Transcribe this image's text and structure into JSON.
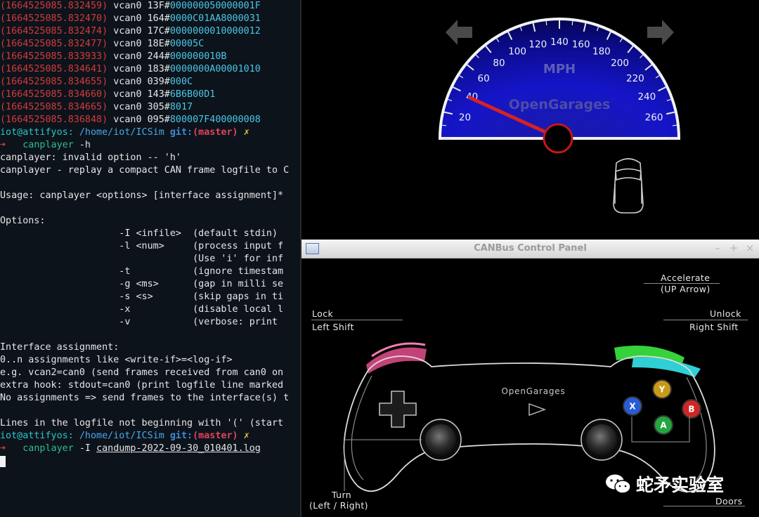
{
  "terminal": {
    "dump_lines": [
      {
        "ts": "(1664525085.832459)",
        "iface": "vcan0",
        "id": "13F",
        "data": "00000005",
        "data_hi": "0000001F"
      },
      {
        "ts": "(1664525085.832470)",
        "iface": "vcan0",
        "id": "164",
        "data": "0000C01AA8000031",
        "data_hi": ""
      },
      {
        "ts": "(1664525085.832474)",
        "iface": "vcan0",
        "id": "17C",
        "data": "0000000010000012",
        "data_hi": ""
      },
      {
        "ts": "(1664525085.832477)",
        "iface": "vcan0",
        "id": "18E",
        "data": "00005C",
        "data_hi": ""
      },
      {
        "ts": "(1664525085.833933)",
        "iface": "vcan0",
        "id": "244",
        "data": "000000010B",
        "data_hi": ""
      },
      {
        "ts": "(1664525085.834641)",
        "iface": "vcan0",
        "id": "183",
        "data": "0000000A00001010",
        "data_hi": ""
      },
      {
        "ts": "(1664525085.834655)",
        "iface": "vcan0",
        "id": "039",
        "data": "000C",
        "data_hi": ""
      },
      {
        "ts": "(1664525085.834660)",
        "iface": "vcan0",
        "id": "143",
        "data": "6B6B00D1",
        "data_hi": ""
      },
      {
        "ts": "(1664525085.834665)",
        "iface": "vcan0",
        "id": "305",
        "data": "8017",
        "data_hi": ""
      },
      {
        "ts": "(1664525085.836848)",
        "iface": "vcan0",
        "id": "095",
        "data": "800007F400000008",
        "data_hi": ""
      }
    ],
    "prompt": {
      "user": "iot@attifyos:",
      "path": "/home/iot/ICSim",
      "git": "git:",
      "branch": "(master)",
      "mark": "✗",
      "arrow": "➜"
    },
    "cmd1": {
      "name": "canplayer",
      "args": " -h"
    },
    "output": [
      "canplayer: invalid option -- 'h'",
      "canplayer - replay a compact CAN frame logfile to C",
      "",
      "Usage: canplayer <options> [interface assignment]*",
      "",
      "Options:",
      "                     -I <infile>  (default stdin)",
      "                     -l <num>     (process input f",
      "                                  (Use 'i' for inf",
      "                     -t           (ignore timestam",
      "                     -g <ms>      (gap in milli se",
      "                     -s <s>       (skip gaps in ti",
      "                     -x           (disable local l",
      "                     -v           (verbose: print",
      "",
      "Interface assignment:",
      "0..n assignments like <write-if>=<log-if>",
      "e.g. vcan2=can0 (send frames received from can0 on",
      "extra hook: stdout=can0 (print logfile line marked",
      "No assignments => send frames to the interface(s) t",
      "",
      "Lines in the logfile not beginning with '(' (start"
    ],
    "cmd2": {
      "name": "canplayer",
      "args_prefix": " -I ",
      "file": "candump-2022-09-30_010401.log"
    }
  },
  "dashboard": {
    "speedo_unit": "MPH",
    "brand": "OpenGarages",
    "ticks": [
      "20",
      "40",
      "60",
      "80",
      "100",
      "120",
      "140",
      "160",
      "180",
      "200",
      "220",
      "240",
      "260"
    ],
    "speed_mph": 38,
    "left_arrow_icon": "left-turn-signal-icon",
    "right_arrow_icon": "right-turn-signal-icon",
    "car_icon": "car-doors-icon"
  },
  "control_panel": {
    "title": "CANBus Control Panel",
    "controls": {
      "minimize": "–",
      "maximize": "+",
      "close": "×"
    },
    "accelerate": "Accelerate",
    "accelerate_key": "(UP Arrow)",
    "lock": "Lock",
    "lock_key": "Left Shift",
    "unlock": "Unlock",
    "unlock_key": "Right Shift",
    "controller_brand": "OpenGarages",
    "buttons": {
      "y": "Y",
      "x": "X",
      "b": "B",
      "a": "A"
    },
    "turn": "Turn",
    "turn_key": "(Left / Right)",
    "doors": "Doors",
    "colors": {
      "y": "#c99a18",
      "x": "#2a5bd6",
      "b": "#cf2626",
      "a": "#23a640",
      "lock_bumper": "#e0508a",
      "unlock_bumper": "#37d63b",
      "trigger_cyan": "#2fd3d8"
    }
  },
  "watermark": "蛇矛实验室"
}
